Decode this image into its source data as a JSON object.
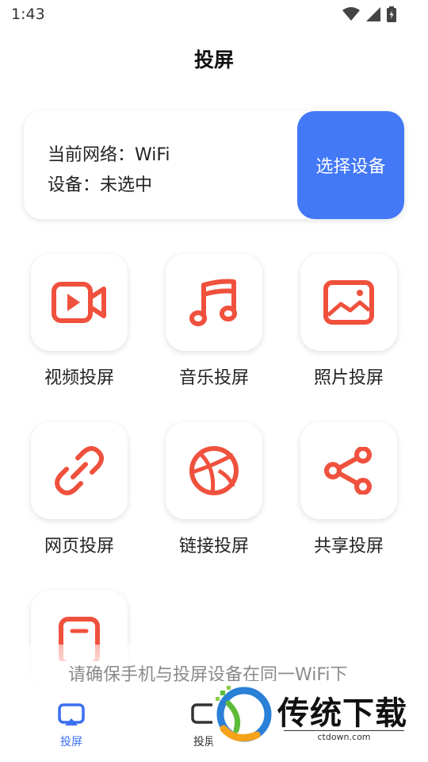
{
  "status_bar": {
    "time": "1:43"
  },
  "page": {
    "title": "投屏"
  },
  "device_card": {
    "network_line": "当前网络：WiFi",
    "device_line": "设备：未选中",
    "select_button": "选择设备"
  },
  "features": [
    {
      "label": "视频投屏",
      "icon": "video-icon"
    },
    {
      "label": "音乐投屏",
      "icon": "music-note-icon"
    },
    {
      "label": "照片投屏",
      "icon": "image-icon"
    },
    {
      "label": "网页投屏",
      "icon": "link-icon"
    },
    {
      "label": "链接投屏",
      "icon": "basketball-icon"
    },
    {
      "label": "共享投屏",
      "icon": "share-icon"
    },
    {
      "label": "",
      "icon": "document-icon"
    }
  ],
  "tip": {
    "text": "请确保手机与投屏设备在同一WiFi下"
  },
  "tabbar": {
    "tabs": [
      {
        "label": "投屏",
        "icon": "cast-icon",
        "active": true
      },
      {
        "label": "投屏",
        "icon": "cast-icon",
        "active": false
      }
    ]
  },
  "watermark": {
    "name": "传统下载",
    "url": "ctdown.com"
  },
  "colors": {
    "accent_blue": "#4378f6",
    "icon_red": "#f0513d",
    "active_tab": "#3a6ff0"
  }
}
